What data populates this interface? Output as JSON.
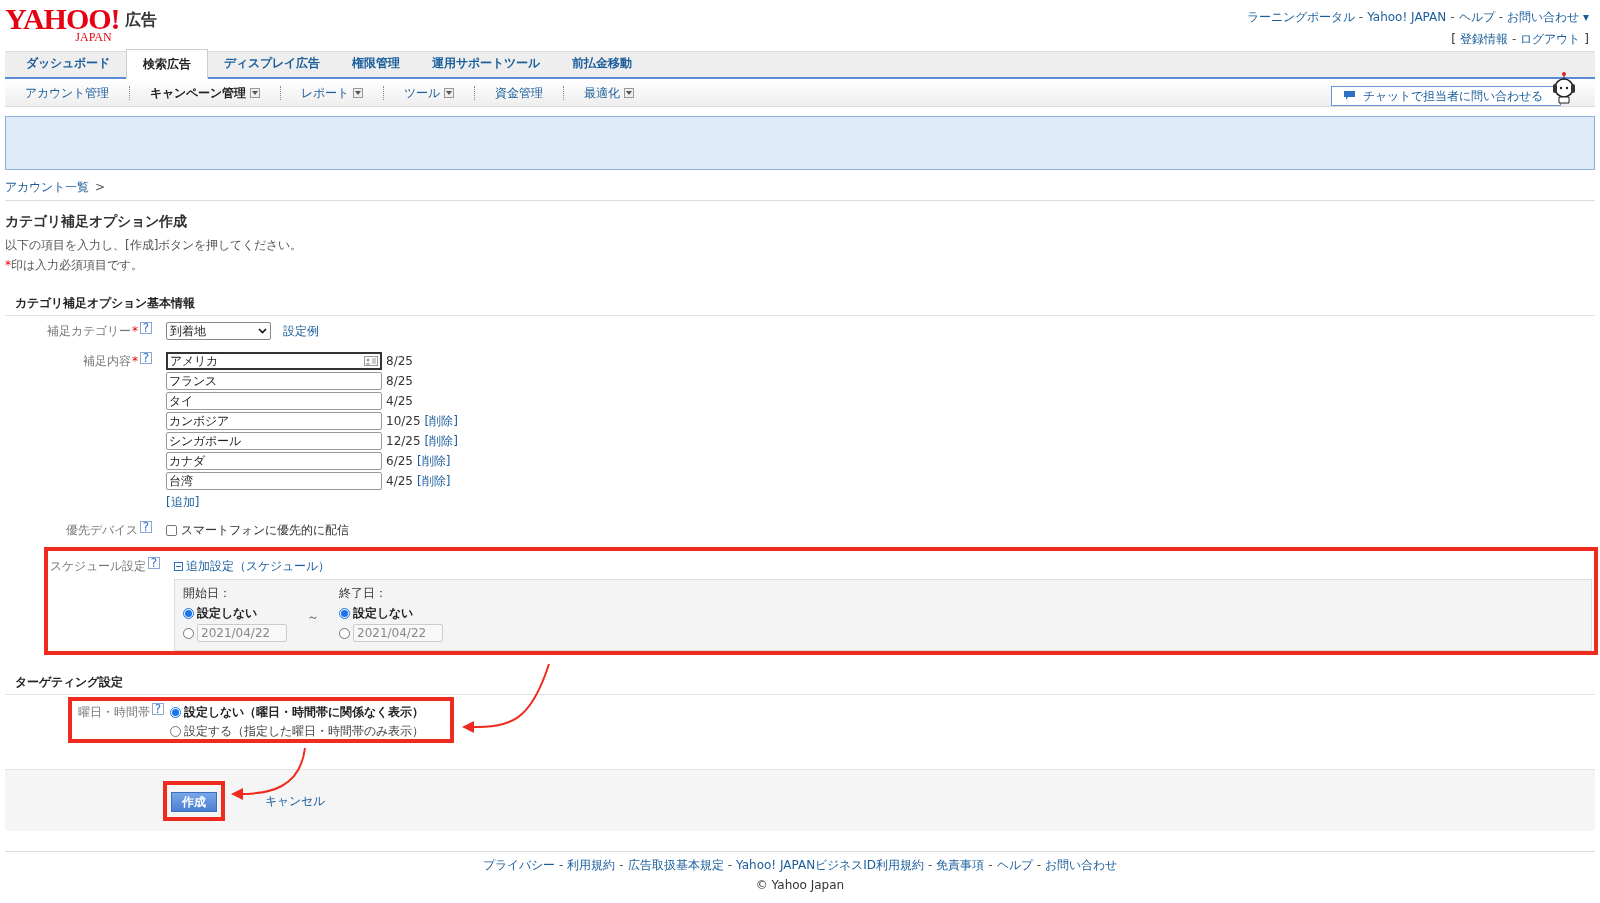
{
  "header": {
    "logo": {
      "brand": "YAHOO!",
      "sub": "JAPAN",
      "service": "広告"
    },
    "top_links": [
      "ラーニングポータル",
      "Yahoo! JAPAN",
      "ヘルプ",
      "お問い合わせ"
    ],
    "separator": "-",
    "dropdown_mark": "▾",
    "account_links": {
      "open": "[",
      "items": [
        "登録情報",
        "ログアウト"
      ],
      "close": "]"
    }
  },
  "tabs": [
    {
      "label": "ダッシュボード",
      "selected": false
    },
    {
      "label": "検索広告",
      "selected": true
    },
    {
      "label": "ディスプレイ広告",
      "selected": false
    },
    {
      "label": "権限管理",
      "selected": false
    },
    {
      "label": "運用サポートツール",
      "selected": false
    },
    {
      "label": "前払金移動",
      "selected": false
    }
  ],
  "subnav": [
    {
      "label": "アカウント管理",
      "selected": false,
      "dropdown": false
    },
    {
      "label": "キャンペーン管理",
      "selected": true,
      "dropdown": true
    },
    {
      "label": "レポート",
      "selected": false,
      "dropdown": true
    },
    {
      "label": "ツール",
      "selected": false,
      "dropdown": true
    },
    {
      "label": "資金管理",
      "selected": false,
      "dropdown": false
    },
    {
      "label": "最適化",
      "selected": false,
      "dropdown": true
    }
  ],
  "chat_button": "チャットで担当者に問い合わせる",
  "breadcrumb": {
    "items": [
      "アカウント一覧"
    ],
    "separator": ">"
  },
  "page": {
    "title": "カテゴリ補足オプション作成",
    "instruction": "以下の項目を入力し、[作成]ボタンを押してください。",
    "required_mark": "*",
    "required_note": "印は入力必須項目です。"
  },
  "basic_section": {
    "title": "カテゴリ補足オプション基本情報",
    "help": "?",
    "required_mark": "*",
    "category": {
      "label": "補足カテゴリー",
      "required": true,
      "value": "到着地",
      "example_link": "設定例"
    },
    "content": {
      "label": "補足内容",
      "required": true,
      "items": [
        {
          "value": "アメリカ",
          "count": "8/25",
          "focused": true
        },
        {
          "value": "フランス",
          "count": "8/25",
          "focused": false
        },
        {
          "value": "タイ",
          "count": "4/25",
          "focused": false
        },
        {
          "value": "カンボジア",
          "count": "10/25",
          "focused": false,
          "delete_link": "[削除]"
        },
        {
          "value": "シンガポール",
          "count": "12/25",
          "focused": false,
          "delete_link": "[削除]"
        },
        {
          "value": "カナダ",
          "count": "6/25",
          "focused": false,
          "delete_link": "[削除]"
        },
        {
          "value": "台湾",
          "count": "4/25",
          "focused": false,
          "delete_link": "[削除]"
        }
      ],
      "add_link": "[追加]"
    },
    "device": {
      "label": "優先デバイス",
      "checkbox_label": "スマートフォンに優先的に配信",
      "checked": false
    },
    "schedule": {
      "label": "スケジュール設定",
      "toggle_label": "追加設定（スケジュール）",
      "expanded": true,
      "highlighted": true,
      "range_mark": "～",
      "start": {
        "label": "開始日：",
        "options": [
          {
            "kind": "text",
            "label": "設定しない",
            "selected": true
          },
          {
            "kind": "date",
            "placeholder": "2021/04/22",
            "selected": false
          }
        ]
      },
      "end": {
        "label": "終了日：",
        "options": [
          {
            "kind": "text",
            "label": "設定しない",
            "selected": true
          },
          {
            "kind": "date",
            "placeholder": "2021/04/22",
            "selected": false
          }
        ]
      }
    }
  },
  "targeting_section": {
    "title": "ターゲティング設定",
    "weekday": {
      "label": "曜日・時間帯",
      "highlighted": true,
      "options": [
        {
          "label": "設定しない（曜日・時間帯に関係なく表示）",
          "selected": true
        },
        {
          "label": "設定する（指定した曜日・時間帯のみ表示）",
          "selected": false
        }
      ]
    }
  },
  "actions": {
    "submit": "作成",
    "cancel": "キャンセル",
    "submit_highlighted": true
  },
  "footer": {
    "links": [
      "プライバシー",
      "利用規約",
      "広告取扱基本規定",
      "Yahoo! JAPANビジネスID利用規約",
      "免責事項",
      "ヘルプ",
      "お問い合わせ"
    ],
    "separator": "-",
    "copyright": "© Yahoo Japan"
  }
}
